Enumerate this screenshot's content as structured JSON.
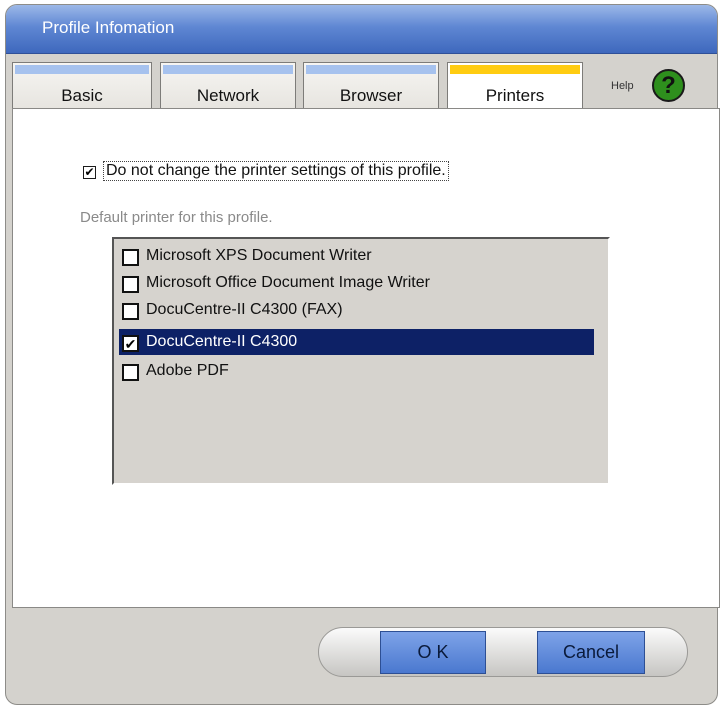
{
  "window": {
    "title": "Profile Infomation"
  },
  "tabs": [
    {
      "label": "Basic",
      "active": false
    },
    {
      "label": "Network",
      "active": false
    },
    {
      "label": "Browser",
      "active": false
    },
    {
      "label": "Printers",
      "active": true
    }
  ],
  "help": {
    "label": "Help",
    "icon": "question-mark-icon",
    "symbol": "?"
  },
  "settings": {
    "lock_checkbox": {
      "checked": true,
      "label": "Do not change the printer settings of this profile."
    },
    "default_printer_label": "Default printer for this profile."
  },
  "printers": [
    {
      "name": "Microsoft XPS Document Writer",
      "checked": false,
      "selected": false
    },
    {
      "name": "Microsoft Office Document Image Writer",
      "checked": false,
      "selected": false
    },
    {
      "name": "DocuCentre-II C4300 (FAX)",
      "checked": false,
      "selected": false
    },
    {
      "name": "DocuCentre-II C4300",
      "checked": true,
      "selected": true
    },
    {
      "name": "Adobe PDF",
      "checked": false,
      "selected": false
    }
  ],
  "buttons": {
    "ok": "O K",
    "cancel": "Cancel"
  },
  "colors": {
    "title_bar": "#3e68bd",
    "active_tab_accent": "#ffcc11",
    "selection": "#0d2166",
    "button": "#4a78cf"
  }
}
